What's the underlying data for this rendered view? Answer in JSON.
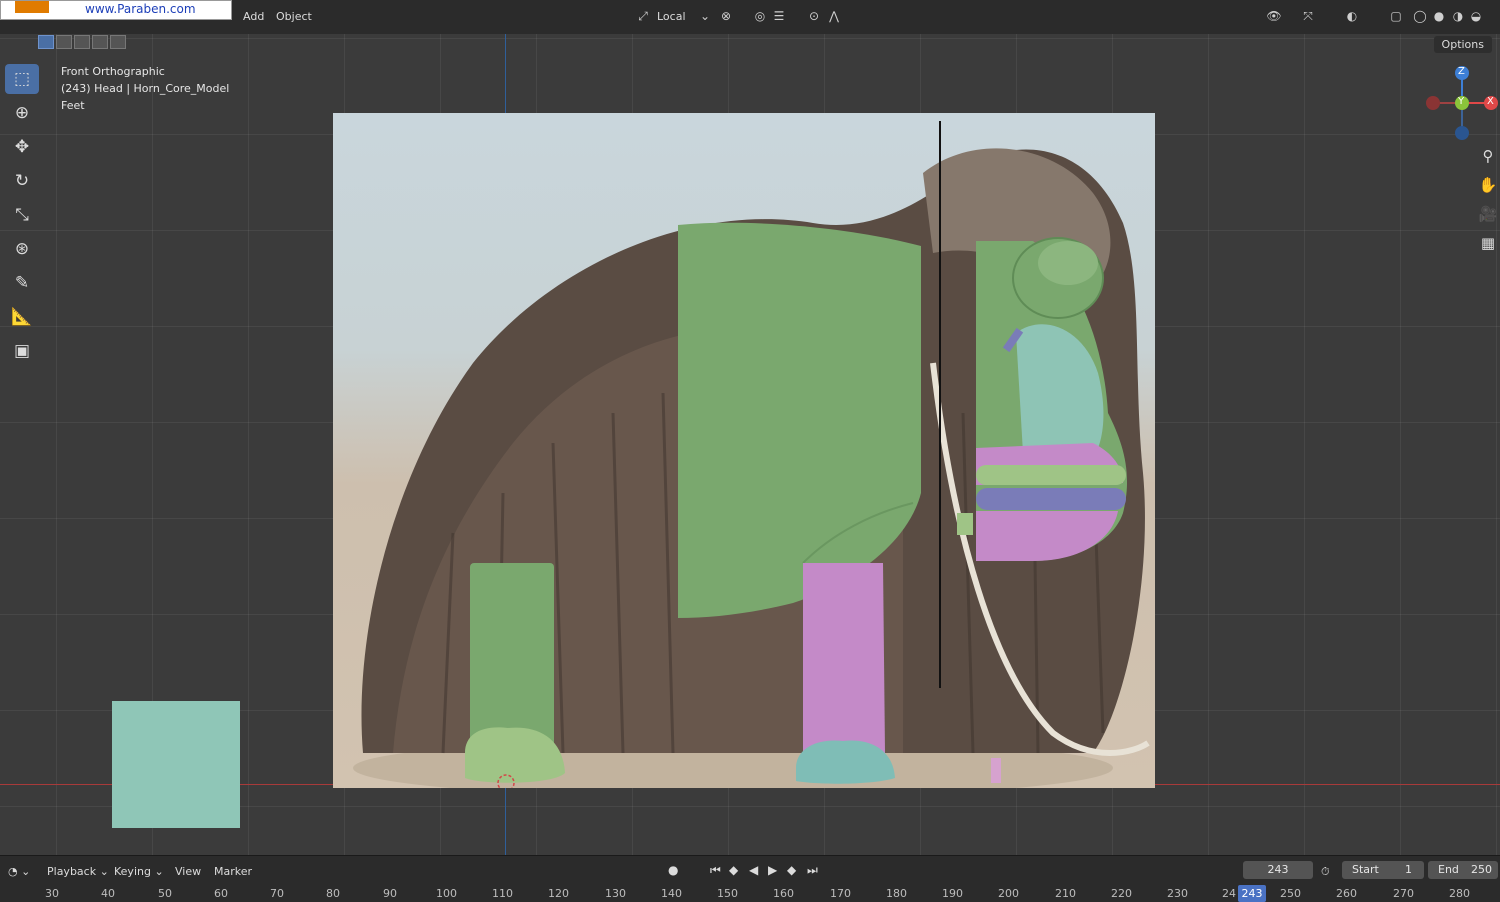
{
  "watermark": {
    "url": "www.Paraben.com"
  },
  "header": {
    "menus": [
      "Add",
      "Object"
    ],
    "transform_orientation": "Local",
    "options_label": "Options"
  },
  "overlay": {
    "view_name": "Front Orthographic",
    "object_info": "(243) Head | Horn_Core_Model",
    "collection": "Feet"
  },
  "gizmo": {
    "z": "Z",
    "y": "Y",
    "x": "X"
  },
  "timeline": {
    "menus": [
      "Playback",
      "Keying",
      "View",
      "Marker"
    ],
    "current_frame": "243",
    "start_label": "Start",
    "start_value": "1",
    "end_label": "End",
    "end_value": "250",
    "ruler_ticks": [
      "30",
      "40",
      "50",
      "60",
      "70",
      "80",
      "90",
      "100",
      "110",
      "120",
      "130",
      "140",
      "150",
      "160",
      "170",
      "180",
      "190",
      "200",
      "210",
      "220",
      "230",
      "24",
      "250",
      "260",
      "270",
      "280"
    ],
    "ruler_current": "243"
  },
  "colors": {
    "accent": "#4a72c4",
    "model_green": "#7aa86e",
    "model_pink": "#c48ac8",
    "model_teal": "#7fbdb6",
    "swatch": "#8fc6b7",
    "axis_x": "#e04848",
    "axis_y": "#8bc43a",
    "axis_z": "#3d7fd6"
  }
}
